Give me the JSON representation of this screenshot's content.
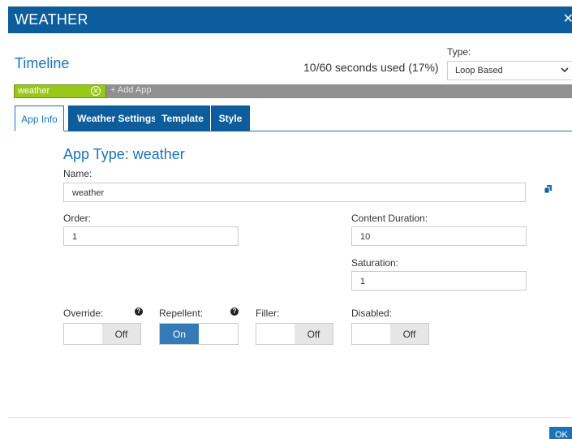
{
  "window": {
    "title": "WEATHER",
    "close_glyph": "✕"
  },
  "timeline": {
    "title": "Timeline",
    "seconds_used": "10/60 seconds used (17%)",
    "type_label": "Type:",
    "type_value": "Loop Based"
  },
  "app_bar": {
    "active_app": "weather",
    "add_app": "+ Add App"
  },
  "tabs": [
    {
      "label": "App Info"
    },
    {
      "label": "Weather Settings"
    },
    {
      "label": "Template"
    },
    {
      "label": "Style"
    }
  ],
  "form": {
    "app_type_heading": "App Type: weather",
    "name_label": "Name:",
    "name_value": "weather",
    "order_label": "Order:",
    "order_value": "1",
    "content_duration_label": "Content Duration:",
    "content_duration_value": "10",
    "saturation_label": "Saturation:",
    "saturation_value": "1"
  },
  "toggles": {
    "override": {
      "label": "Override:",
      "state": "Off"
    },
    "repellent": {
      "label": "Repellent:",
      "state": "On"
    },
    "filler": {
      "label": "Filler:",
      "state": "Off"
    },
    "disabled": {
      "label": "Disabled:",
      "state": "Off"
    }
  },
  "help_glyph": "?",
  "footer": {
    "ok_label": "OK"
  },
  "colors": {
    "header_blue": "#0d5d9c",
    "accent_blue": "#1a73b8",
    "app_green": "#9ac81a",
    "bar_gray": "#909090",
    "toggle_on": "#337ab7"
  },
  "icons": [
    "close-icon",
    "chevron-down-icon",
    "remove-circle-icon",
    "copy-icon",
    "help-icon"
  ]
}
